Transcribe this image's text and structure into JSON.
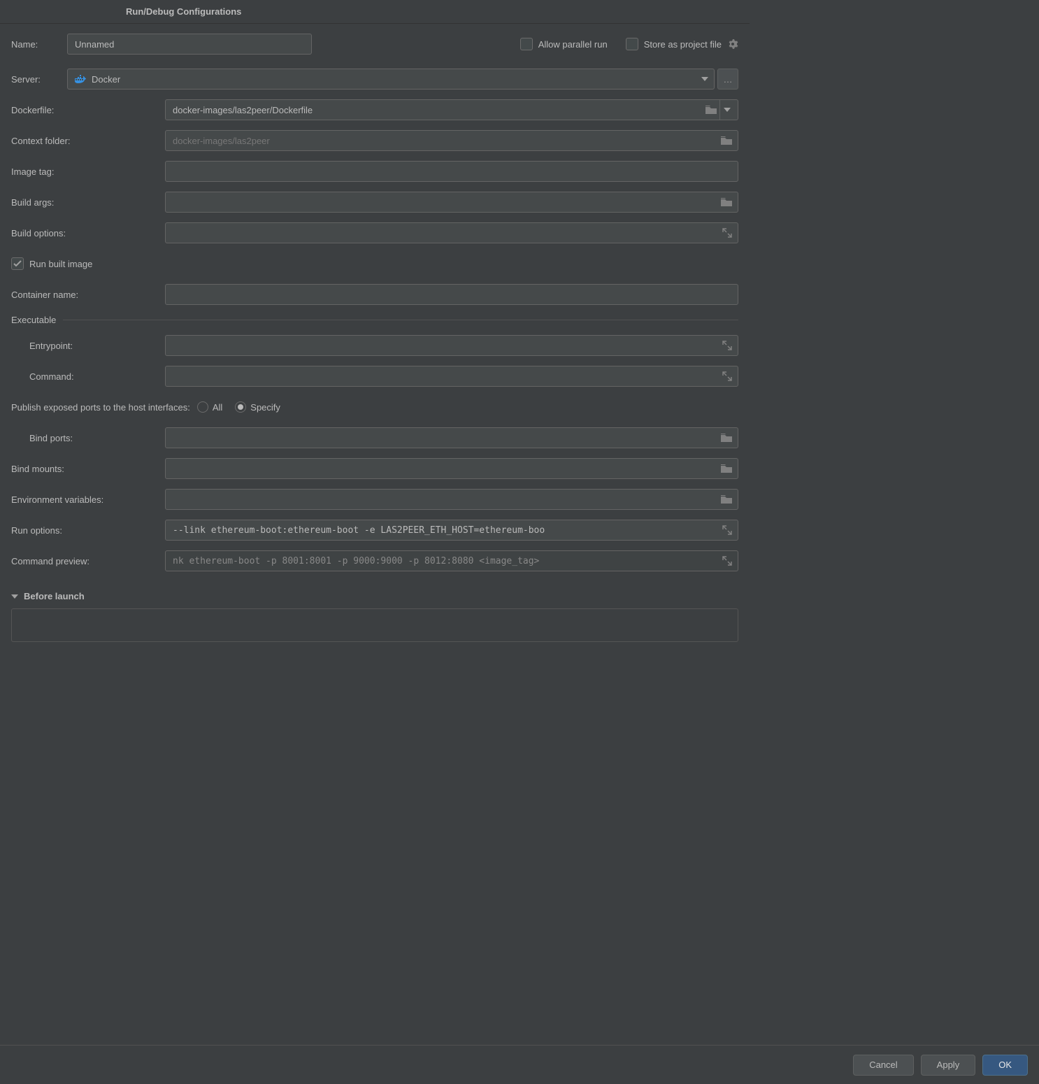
{
  "title": "Run/Debug Configurations",
  "top": {
    "name_label": "Name:",
    "name_value": "Unnamed",
    "allow_parallel_label": "Allow parallel run",
    "allow_parallel_checked": false,
    "store_file_label": "Store as project file",
    "store_file_checked": false
  },
  "server": {
    "label": "Server:",
    "value": "Docker"
  },
  "fields": {
    "dockerfile_label": "Dockerfile:",
    "dockerfile_value": "docker-images/las2peer/Dockerfile",
    "context_label": "Context folder:",
    "context_placeholder": "docker-images/las2peer",
    "image_tag_label": "Image tag:",
    "image_tag_value": "",
    "build_args_label": "Build args:",
    "build_args_value": "",
    "build_options_label": "Build options:",
    "build_options_value": "",
    "run_built_image_label": "Run built image",
    "run_built_image_checked": true,
    "container_name_label": "Container name:",
    "container_name_value": ""
  },
  "executable": {
    "header": "Executable",
    "entrypoint_label": "Entrypoint:",
    "entrypoint_value": "",
    "command_label": "Command:",
    "command_value": ""
  },
  "ports": {
    "label": "Publish exposed ports to the host interfaces:",
    "option_all": "All",
    "option_specify": "Specify",
    "selected": "Specify",
    "bind_ports_label": "Bind ports:",
    "bind_ports_value": ""
  },
  "more": {
    "bind_mounts_label": "Bind mounts:",
    "bind_mounts_value": "",
    "env_label": "Environment variables:",
    "env_value": "",
    "run_options_label": "Run options:",
    "run_options_value": "--link ethereum-boot:ethereum-boot -e LAS2PEER_ETH_HOST=ethereum-boo",
    "cmd_preview_label": "Command preview:",
    "cmd_preview_value": "nk ethereum-boot -p 8001:8001 -p 9000:9000 -p 8012:8080 <image_tag>"
  },
  "before_launch": {
    "header": "Before launch"
  },
  "buttons": {
    "cancel": "Cancel",
    "apply": "Apply",
    "ok": "OK"
  }
}
